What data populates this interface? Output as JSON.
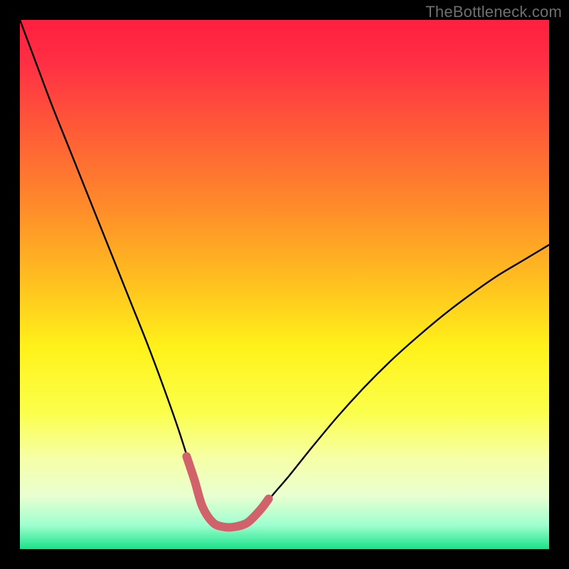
{
  "watermark": "TheBottleneck.com",
  "chart_data": {
    "type": "line",
    "title": "",
    "xlabel": "",
    "ylabel": "",
    "xlim": [
      0,
      100
    ],
    "ylim": [
      0,
      100
    ],
    "grid": false,
    "legend": false,
    "gradient_stops": [
      {
        "offset": 0.0,
        "color": "#ff1f3f"
      },
      {
        "offset": 0.08,
        "color": "#ff2f44"
      },
      {
        "offset": 0.2,
        "color": "#ff5838"
      },
      {
        "offset": 0.35,
        "color": "#ff8a2a"
      },
      {
        "offset": 0.5,
        "color": "#ffc21f"
      },
      {
        "offset": 0.62,
        "color": "#fff21a"
      },
      {
        "offset": 0.74,
        "color": "#fbff4a"
      },
      {
        "offset": 0.83,
        "color": "#f6ffa8"
      },
      {
        "offset": 0.9,
        "color": "#e8ffd1"
      },
      {
        "offset": 0.955,
        "color": "#9dffcf"
      },
      {
        "offset": 1.0,
        "color": "#18e38a"
      }
    ],
    "series": [
      {
        "name": "bottleneck-curve",
        "stroke": "#000000",
        "stroke_width": 2.4,
        "x": [
          0.0,
          3.0,
          6.0,
          9.0,
          12.0,
          15.0,
          18.0,
          21.0,
          24.0,
          27.0,
          30.0,
          33.0,
          34.5,
          36.5,
          38.5,
          40.5,
          43.0,
          45.5,
          48.0,
          51.0,
          55.0,
          60.0,
          65.0,
          70.0,
          75.0,
          80.0,
          85.0,
          90.0,
          95.0,
          100.0
        ],
        "y": [
          100.0,
          92.0,
          84.0,
          76.5,
          69.0,
          61.5,
          54.0,
          46.5,
          39.0,
          31.0,
          22.5,
          13.0,
          8.0,
          5.0,
          4.2,
          4.2,
          5.0,
          7.5,
          10.5,
          14.0,
          19.0,
          25.0,
          30.5,
          35.5,
          40.0,
          44.2,
          48.0,
          51.5,
          54.5,
          57.5
        ]
      },
      {
        "name": "valley-highlight",
        "stroke": "#d1626c",
        "stroke_width": 12,
        "x": [
          31.5,
          33.0,
          34.5,
          36.5,
          38.5,
          40.5,
          43.0,
          45.5,
          47.0
        ],
        "y": [
          17.5,
          13.0,
          8.0,
          5.0,
          4.2,
          4.2,
          5.0,
          7.5,
          9.5
        ]
      }
    ]
  }
}
